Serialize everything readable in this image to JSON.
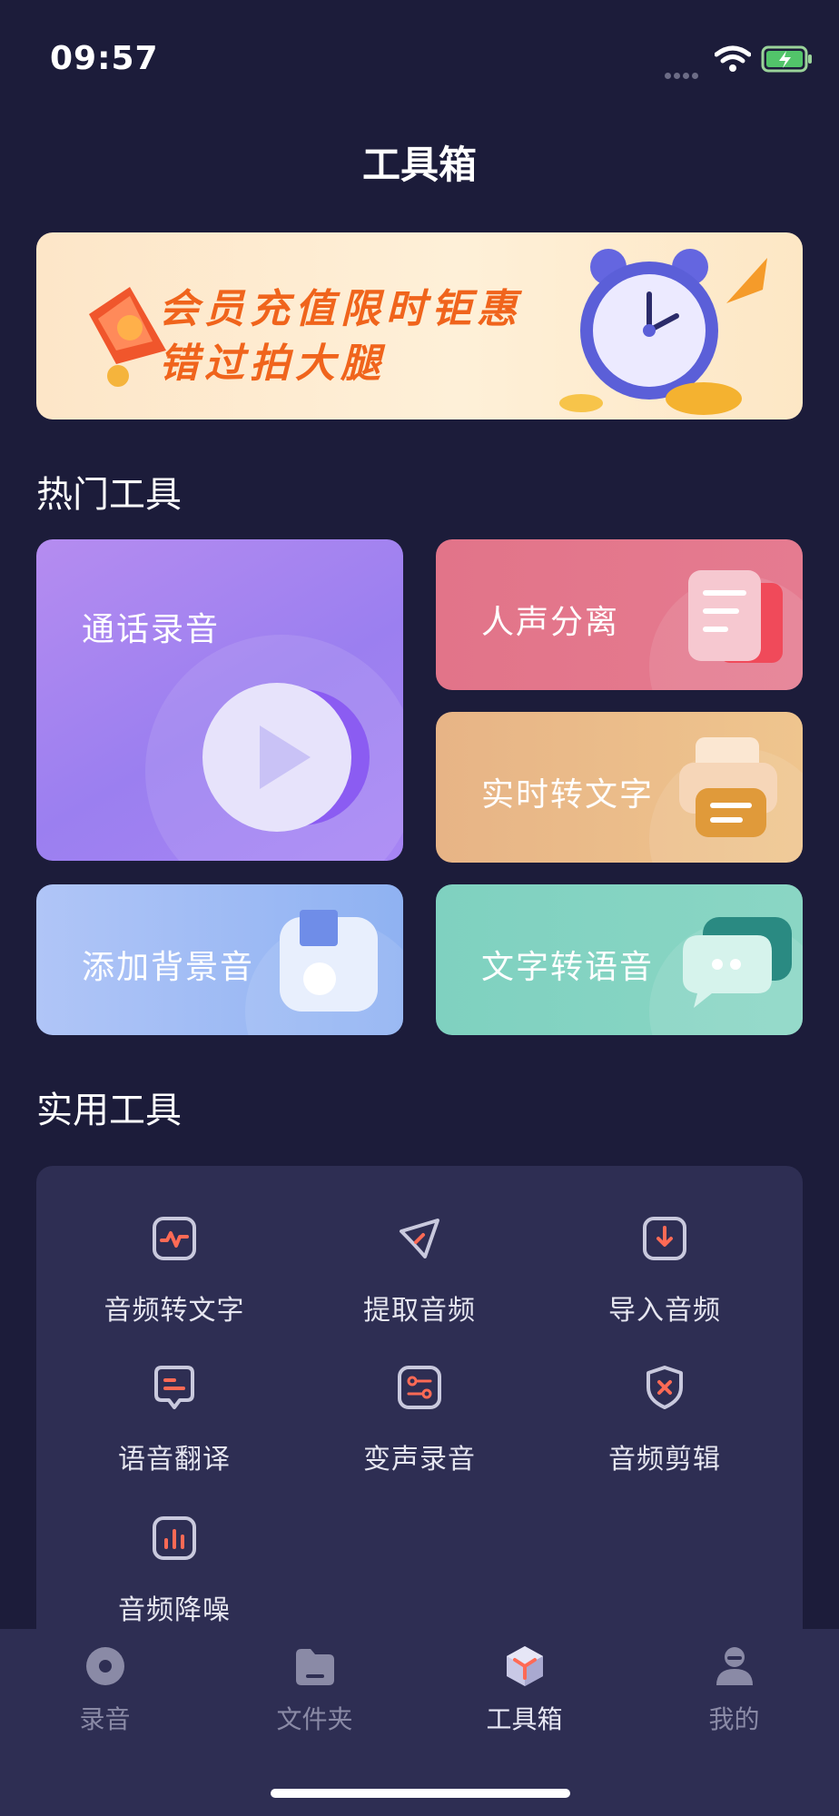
{
  "status_bar": {
    "time": "09:57"
  },
  "header": {
    "title": "工具箱"
  },
  "banner": {
    "line1": "会员充值限时钜惠",
    "line2": "错过拍大腿"
  },
  "hot_tools": {
    "title": "热门工具",
    "items": [
      {
        "label": "通话录音",
        "icon": "play-icon",
        "color": "#9b7ff0"
      },
      {
        "label": "人声分离",
        "icon": "document-icon",
        "color": "#e27489"
      },
      {
        "label": "实时转文字",
        "icon": "printer-icon",
        "color": "#ecbf85"
      },
      {
        "label": "添加背景音",
        "icon": "sd-card-icon",
        "color": "#8fb2f2"
      },
      {
        "label": "文字转语音",
        "icon": "chat-bubble-icon",
        "color": "#7fd1c0"
      }
    ]
  },
  "practical_tools": {
    "title": "实用工具",
    "items": [
      {
        "label": "音频转文字",
        "icon": "waveform-icon"
      },
      {
        "label": "提取音频",
        "icon": "send-icon"
      },
      {
        "label": "导入音频",
        "icon": "import-icon"
      },
      {
        "label": "语音翻译",
        "icon": "message-icon"
      },
      {
        "label": "变声录音",
        "icon": "sliders-icon"
      },
      {
        "label": "音频剪辑",
        "icon": "close-shield-icon"
      },
      {
        "label": "音频降噪",
        "icon": "bar-chart-icon"
      }
    ]
  },
  "tabbar": {
    "items": [
      {
        "label": "录音",
        "icon": "record-icon",
        "active": false
      },
      {
        "label": "文件夹",
        "icon": "folder-icon",
        "active": false
      },
      {
        "label": "工具箱",
        "icon": "toolbox-cube-icon",
        "active": true
      },
      {
        "label": "我的",
        "icon": "profile-icon",
        "active": false
      }
    ]
  },
  "colors": {
    "background": "#1c1c3a",
    "panel": "#2e2e53",
    "accent": "#ff6a55"
  }
}
